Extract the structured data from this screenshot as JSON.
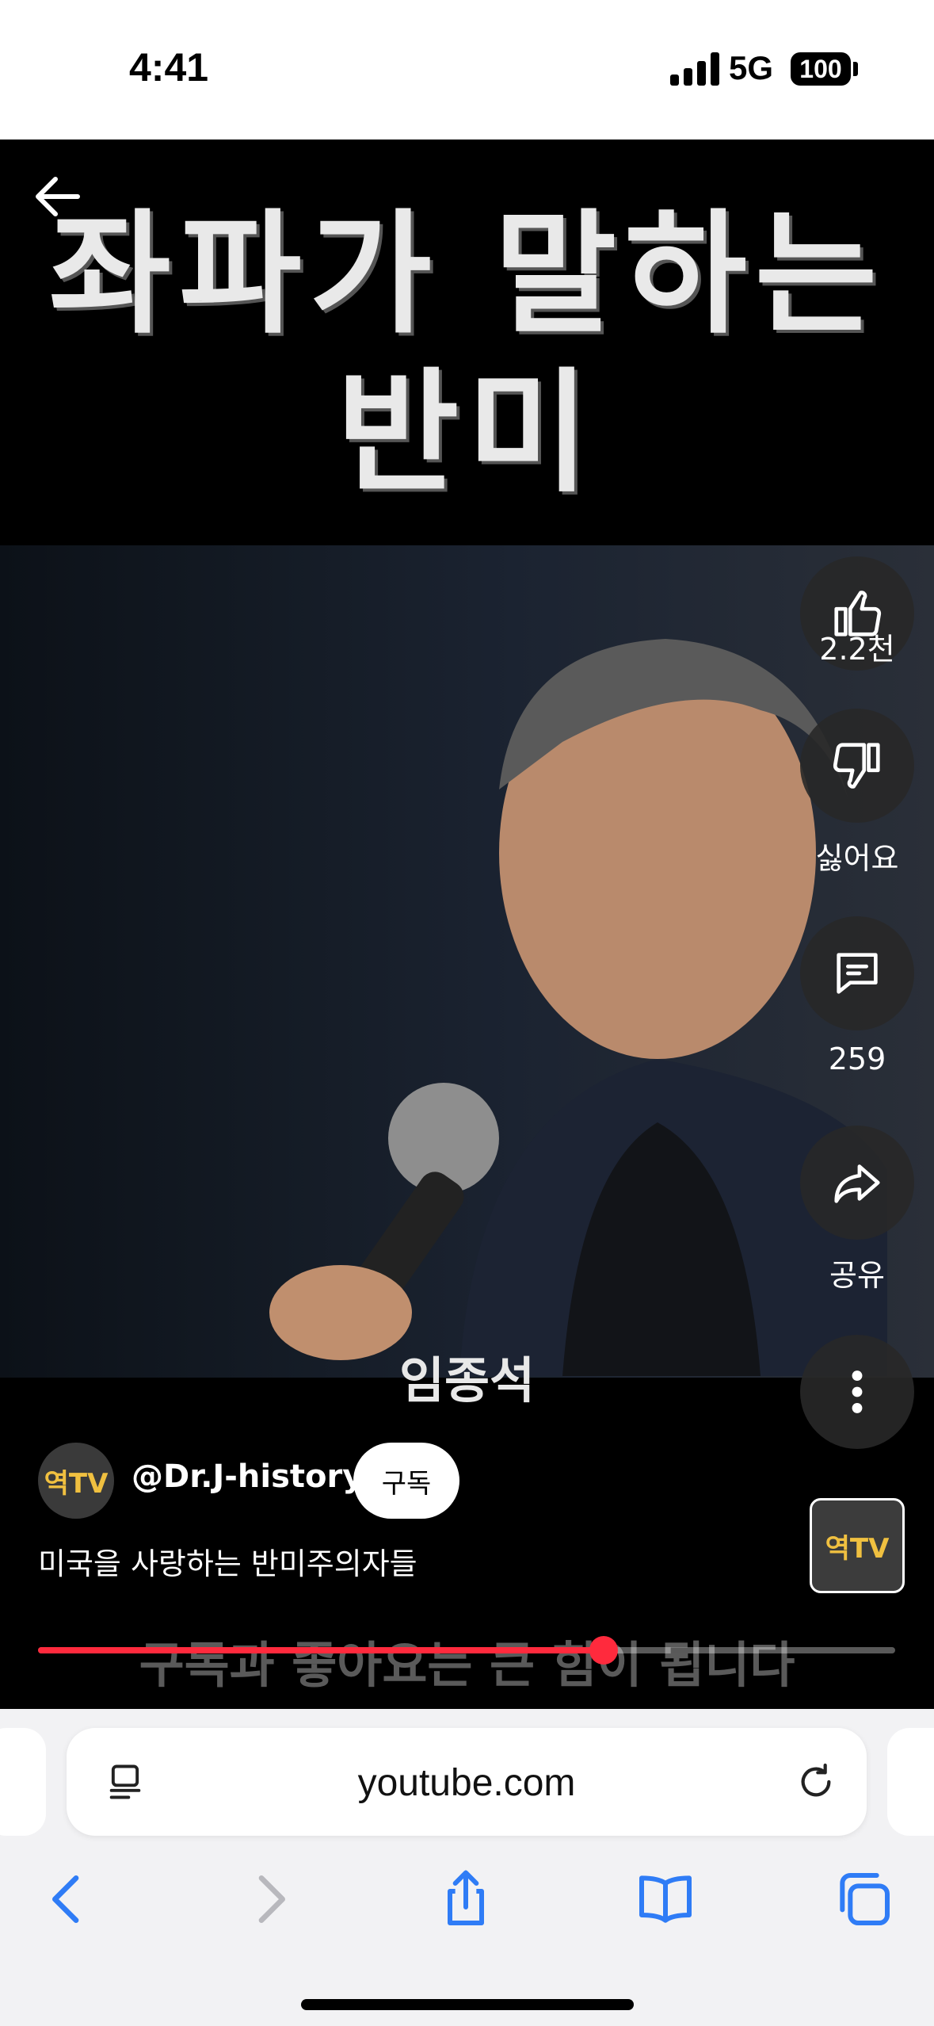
{
  "status_bar": {
    "time": "4:41",
    "network": "5G",
    "battery": "100"
  },
  "video": {
    "title_line1": "좌파가 말하는",
    "title_line2": "반미",
    "name_caption": "임종석",
    "bottom_caption": "구독과 좋아요는 큰 힘이 됩니다",
    "progress": 0.66
  },
  "actions": {
    "like_count": "2.2천",
    "dislike_label": "싫어요",
    "comment_count": "259",
    "share_label": "공유"
  },
  "channel": {
    "avatar_text": "역TV",
    "handle": "@Dr.J-history",
    "subscribe_label": "구독",
    "description": "미국을 사랑하는 반미주의자들"
  },
  "browser": {
    "url": "youtube.com"
  },
  "colors": {
    "accent": "#ff2a3d",
    "safari_blue": "#2f7cf6"
  }
}
